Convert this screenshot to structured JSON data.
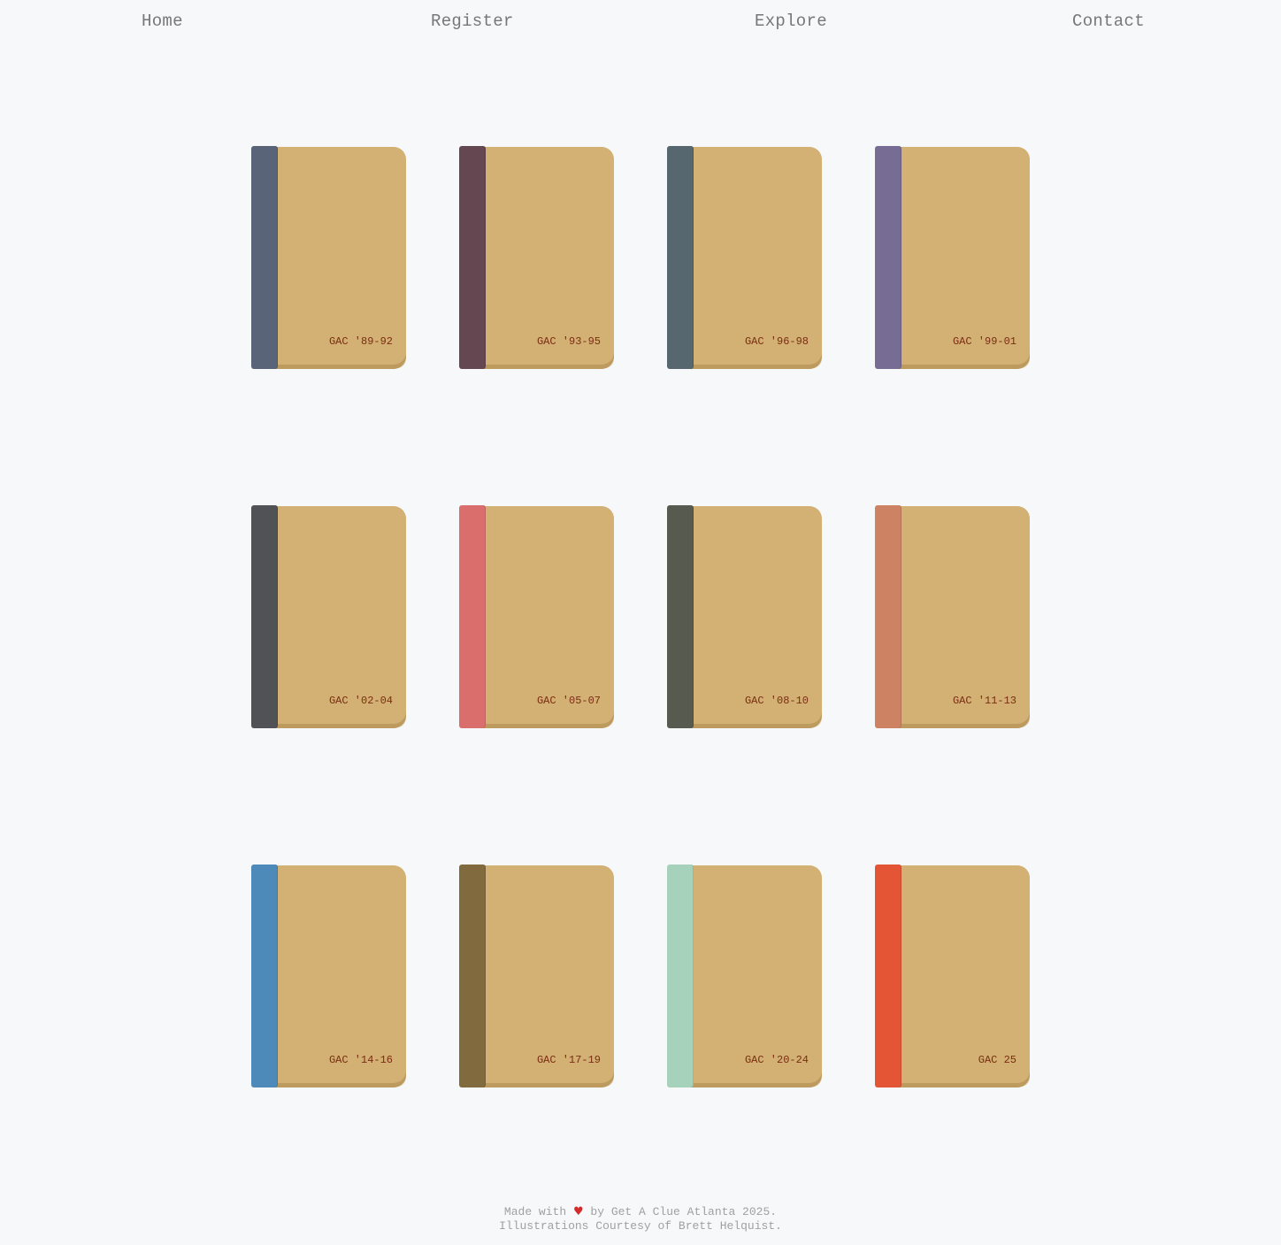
{
  "nav": {
    "home": "Home",
    "register": "Register",
    "explore": "Explore",
    "contact": "Contact"
  },
  "books": [
    {
      "title": "GAC '89-92",
      "spine_color": "#5a6479"
    },
    {
      "title": "GAC '93-95",
      "spine_color": "#654751"
    },
    {
      "title": "GAC '96-98",
      "spine_color": "#566770"
    },
    {
      "title": "GAC '99-01",
      "spine_color": "#776c93"
    },
    {
      "title": "GAC '02-04",
      "spine_color": "#505256"
    },
    {
      "title": "GAC '05-07",
      "spine_color": "#d96e6d"
    },
    {
      "title": "GAC '08-10",
      "spine_color": "#565a4f"
    },
    {
      "title": "GAC '11-13",
      "spine_color": "#cd8264"
    },
    {
      "title": "GAC '14-16",
      "spine_color": "#4d8ab9"
    },
    {
      "title": "GAC '17-19",
      "spine_color": "#816b3e"
    },
    {
      "title": "GAC '20-24",
      "spine_color": "#a6d2bb"
    },
    {
      "title": "GAC 25",
      "spine_color": "#e35535"
    }
  ],
  "theme": {
    "cover_color": "#d3b073",
    "title_color": "#7a2d12",
    "background": "#f7f8fa",
    "heart_color": "#d42a2a"
  },
  "footer": {
    "made_with": "Made with",
    "heart_icon": "heart-icon",
    "by_line": "by Get A Clue Atlanta 2025.",
    "credits": "Illustrations Courtesy of Brett Helquist."
  }
}
